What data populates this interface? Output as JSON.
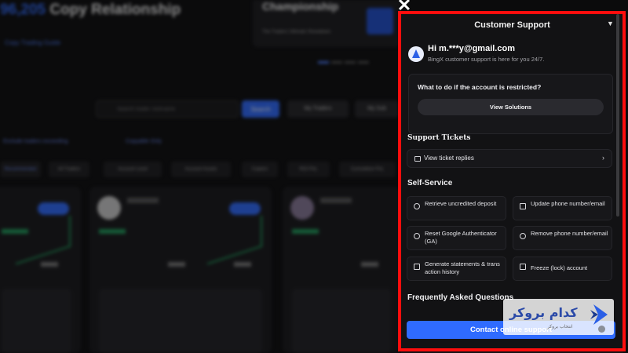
{
  "background": {
    "title_prefix": "96,205",
    "title_suffix": " Copy Relationship",
    "trading_guide_link": "Copy Trading Guide",
    "banner_title": "Championship",
    "banner_subtitle": "The Traders Ultimate Showdown",
    "search_placeholder": "Search trader nickname",
    "search_button": "Search",
    "filter_button_1": "My Traders",
    "filter_button_2": "My Sub",
    "check_1": "Exclude traders exceeding",
    "check_2": "Copyable Only",
    "tabs": [
      "Recommended",
      "All Traders",
      "Account Level",
      "Account Assets",
      "Copiers",
      "ROI PnL",
      "Cumulative PnL"
    ]
  },
  "panel": {
    "title": "Customer Support",
    "collapse_icon": "chevron-down-icon",
    "greeting_name": "Hi m.***y@gmail.com",
    "greeting_sub": "BingX customer support is here for you 24/7.",
    "question": "What to do if the account is restricted?",
    "view_solutions": "View Solutions",
    "support_tickets_title": "Support Tickets",
    "view_ticket_replies": "View ticket replies",
    "self_service_title": "Self-Service",
    "self_service": [
      {
        "label": "Retrieve uncredited deposit",
        "icon": "clock-icon"
      },
      {
        "label": "Update phone number/email",
        "icon": "phone-icon"
      },
      {
        "label": "Reset Google Authenticator (GA)",
        "icon": "shield-icon"
      },
      {
        "label": "Remove phone number/email",
        "icon": "remove-icon"
      },
      {
        "label": "Generate statements & transaction history",
        "icon": "document-icon"
      },
      {
        "label": "Freeze (lock) account",
        "icon": "lock-icon"
      }
    ],
    "faq_title": "Frequently Asked Questions",
    "contact_button": "Contact online support"
  },
  "watermark": {
    "main": "کدام بروکر",
    "sub": "انتخاب بروکر"
  },
  "colors": {
    "accent": "#2f6bff",
    "highlight_frame": "#ff0d0d",
    "panel_bg": "#121214"
  }
}
